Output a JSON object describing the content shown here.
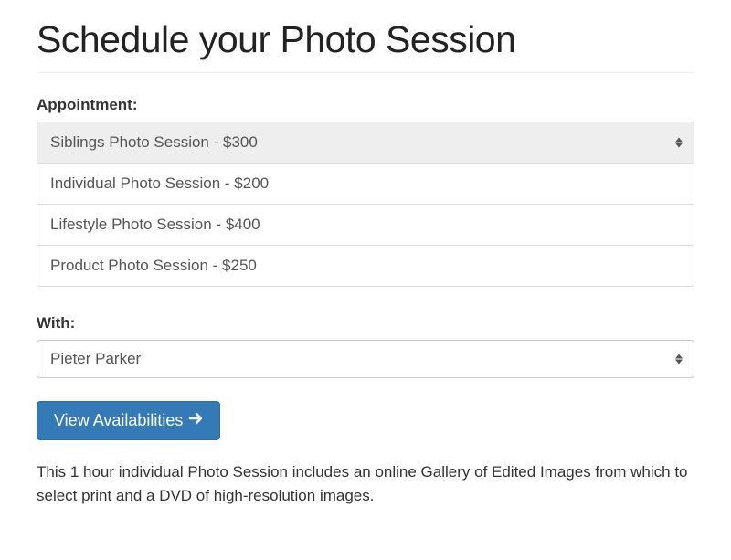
{
  "title": "Schedule your Photo Session",
  "appointment": {
    "label": "Appointment:",
    "options": [
      "Siblings Photo Session - $300",
      "Individual Photo Session - $200",
      "Lifestyle Photo Session - $400",
      "Product Photo Session - $250"
    ]
  },
  "with": {
    "label": "With:",
    "value": "Pieter Parker"
  },
  "button": {
    "label": "View Availabilities"
  },
  "description": "This 1 hour individual Photo Session includes an online Gallery of Edited Images from which to select print and a DVD of high-resolution images."
}
